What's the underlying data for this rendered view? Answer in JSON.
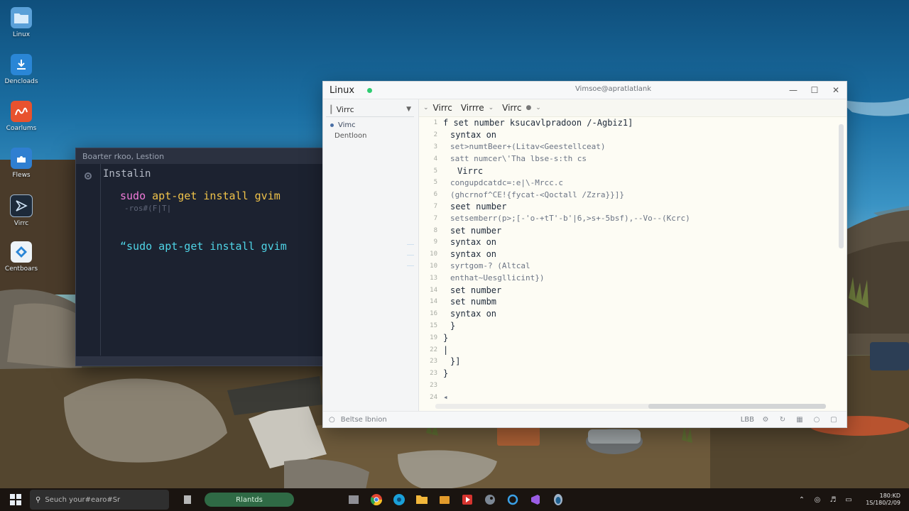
{
  "desktop": {
    "icons": [
      {
        "label": "Linux",
        "icon": "linux-folder-icon"
      },
      {
        "label": "Dencloads",
        "icon": "download-icon"
      },
      {
        "label": "Coarlums",
        "icon": "app-icon"
      },
      {
        "label": "Flews",
        "icon": "puzzle-icon"
      },
      {
        "label": "Virrc",
        "icon": "vim-icon"
      },
      {
        "label": "Centboars",
        "icon": "control-icon"
      }
    ]
  },
  "terminal": {
    "title": "Boarter rkoo, Lestion",
    "heading": "Instalin",
    "cmd1_sudo": "sudo",
    "cmd1_rest": " apt-get install gvim",
    "faint": "-ros#(F|T|",
    "cmd2": "“sudo apt-get install gvim"
  },
  "editor": {
    "app_name": "Linux",
    "window_title": "Vimsoe@apratlatlank",
    "sidebar": {
      "select": "Virrc",
      "items": [
        "Vimc",
        "Dentloon"
      ]
    },
    "tabs": [
      "Virrc",
      "Virrre",
      "Virrc"
    ],
    "lines": [
      {
        "n": "1",
        "indent": 0,
        "text": "f  set number  ksucavlpradoon /-Agbiz1]"
      },
      {
        "n": "2",
        "indent": 1,
        "text": "syntax on"
      },
      {
        "n": "3",
        "indent": 1,
        "text": "set>numtBeer+(Litav<Geestellceat)"
      },
      {
        "n": "4",
        "indent": 1,
        "text": "satt numcer\\'Tha lbse-s:th cs"
      },
      {
        "n": "5",
        "indent": 2,
        "text": "Virrc"
      },
      {
        "n": "5",
        "indent": 1,
        "text": "congupdcatdc=:e|\\-Mrcc.c"
      },
      {
        "n": "6",
        "indent": 1,
        "text": "(ghcrnof^CE!{fycat-<Qoctall /Zzra}}]}"
      },
      {
        "n": "7",
        "indent": 1,
        "text": "seet number"
      },
      {
        "n": "7",
        "indent": 1,
        "text": "setsemberr(p>;[-'o-+tT'-b'|6,>s+-5bsf),--Vo--(Kcrc)"
      },
      {
        "n": "8",
        "indent": 1,
        "text": "set number"
      },
      {
        "n": "9",
        "indent": 1,
        "text": "syntax on"
      },
      {
        "n": "10",
        "indent": 1,
        "text": "syntax on"
      },
      {
        "n": "10",
        "indent": 1,
        "text": "syrtgom-? (Altcal"
      },
      {
        "n": "13",
        "indent": 1,
        "text": "enthat~Uesgllicint})"
      },
      {
        "n": "14",
        "indent": 1,
        "text": "set number"
      },
      {
        "n": "14",
        "indent": 1,
        "text": "set numbm"
      },
      {
        "n": "16",
        "indent": 1,
        "text": "syntax on"
      },
      {
        "n": "15",
        "indent": 1,
        "text": "}"
      },
      {
        "n": "19",
        "indent": 0,
        "text": " }"
      },
      {
        "n": "22",
        "indent": 0,
        "text": " |"
      },
      {
        "n": "23",
        "indent": 1,
        "text": "}]"
      },
      {
        "n": "23",
        "indent": 0,
        "text": "}"
      },
      {
        "n": "23",
        "indent": 0,
        "text": ""
      },
      {
        "n": "24",
        "indent": 0,
        "text": "◂"
      }
    ],
    "status_left": "Beltse lbnion",
    "status_right": "LBB"
  },
  "taskbar": {
    "search_placeholder": "Seuch your#earo#Sr",
    "pill": "Rlantds",
    "clock_time": "180:KD",
    "clock_date": "1S/180/2/09"
  },
  "colors": {
    "accent_green": "#2ecc71",
    "terminal_bg": "#1c2230",
    "editor_bg": "#fdfcf4",
    "cmd_yellow": "#f0c34a",
    "cmd_cyan": "#4fd4e6",
    "cmd_pink": "#f07ad9"
  }
}
